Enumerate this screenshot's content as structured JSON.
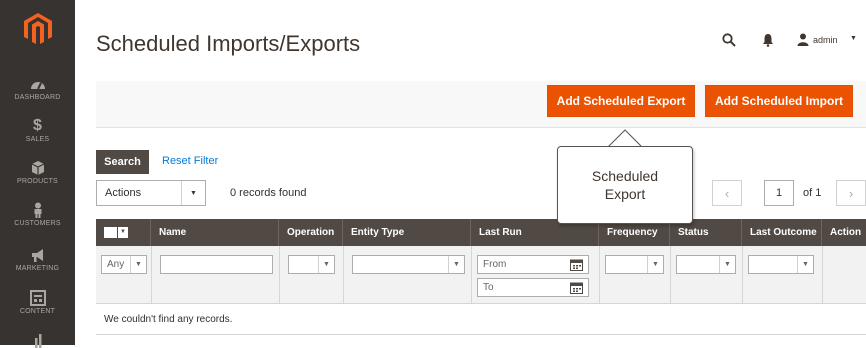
{
  "sidebar": {
    "items": [
      {
        "label": "DASHBOARD",
        "icon": "dashboard-icon"
      },
      {
        "label": "SALES",
        "icon": "dollar-icon"
      },
      {
        "label": "PRODUCTS",
        "icon": "cube-icon"
      },
      {
        "label": "CUSTOMERS",
        "icon": "person-icon"
      },
      {
        "label": "MARKETING",
        "icon": "megaphone-icon"
      },
      {
        "label": "CONTENT",
        "icon": "layout-icon"
      }
    ]
  },
  "header": {
    "title": "Scheduled Imports/Exports",
    "user": "admin"
  },
  "actions": {
    "add_export": "Add Scheduled Export",
    "add_import": "Add Scheduled Import"
  },
  "grid": {
    "search_label": "Search",
    "reset_label": "Reset Filter",
    "mass_action": "Actions",
    "records_found": "0 records found",
    "page_current": "1",
    "page_of": "of 1",
    "columns": [
      "Name",
      "Operation",
      "Entity Type",
      "Last Run",
      "Frequency",
      "Status",
      "Last Outcome",
      "Action"
    ],
    "filters": {
      "select_any": "Any",
      "from_placeholder": "From",
      "to_placeholder": "To"
    },
    "empty_message": "We couldn't find any records."
  },
  "callout": {
    "line1": "Scheduled",
    "line2": "Export"
  },
  "colors": {
    "accent": "#eb5202",
    "sidebar": "#373330",
    "header_row": "#514943",
    "link": "#007bdb"
  }
}
